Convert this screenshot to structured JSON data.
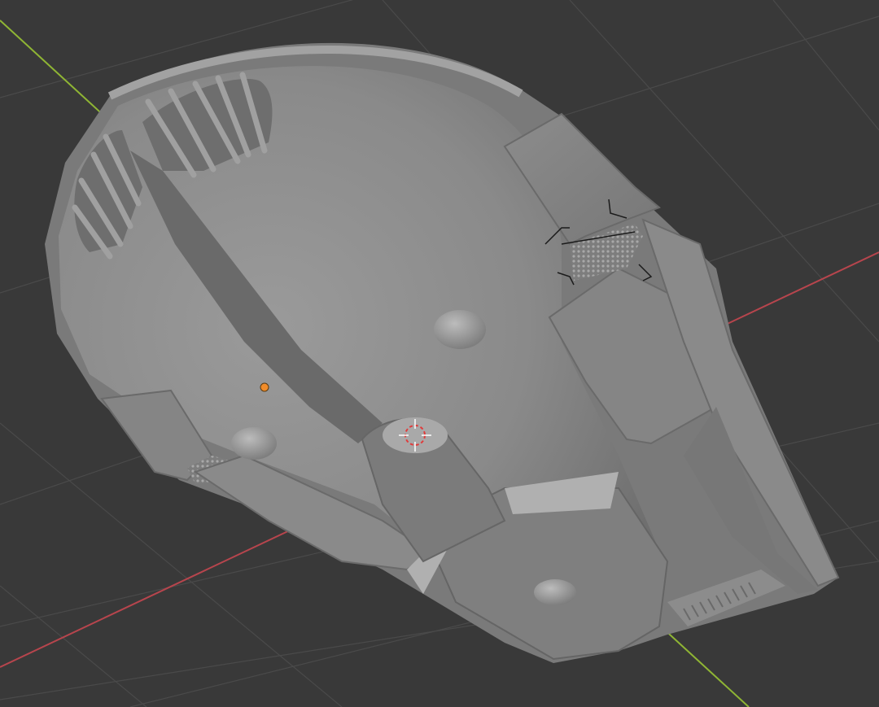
{
  "app": "3D viewport",
  "viewport": {
    "background_color": "#393939",
    "grid_line_color": "#4a4a4a",
    "x_axis_color": "#b7454d",
    "y_axis_color": "#8fb534"
  },
  "model": {
    "base_color": "#8e8e8e",
    "shadow_color": "#6b6b6b",
    "highlight_color": "#b4b4b4"
  },
  "origin_marker": {
    "icon": "origin-dot-icon",
    "color": "#f08c2a"
  },
  "cursor_3d": {
    "icon": "3d-cursor-icon",
    "colors": [
      "#e03b3b",
      "#ffffff"
    ]
  },
  "selection": {
    "icon": "selection-bracket-icon",
    "color": "#1b1b1b"
  }
}
